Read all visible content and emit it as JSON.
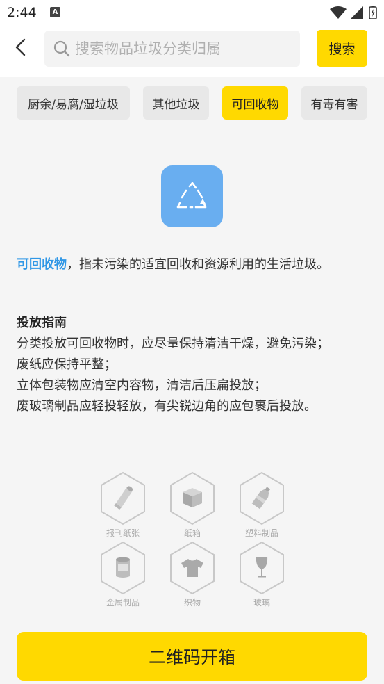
{
  "status_bar": {
    "time": "2:44",
    "notification_badge": "A",
    "icons": [
      "wifi-icon",
      "signal-icon",
      "battery-charging-icon"
    ]
  },
  "header": {
    "back_icon": "chevron-left-icon",
    "search_placeholder": "搜索物品垃圾分类归属",
    "search_value": "",
    "search_button_label": "搜索"
  },
  "tabs": [
    {
      "label": "厨余/易腐/湿垃圾",
      "active": false
    },
    {
      "label": "其他垃圾",
      "active": false
    },
    {
      "label": "可回收物",
      "active": true
    },
    {
      "label": "有毒有害",
      "active": false
    }
  ],
  "category": {
    "icon": "recycle-icon",
    "icon_color": "#69aef0",
    "name": "可回收物",
    "definition": "，指未污染的适宜回收和资源利用的生活垃圾。",
    "accent_color": "#2f97e6"
  },
  "guide": {
    "title": "投放指南",
    "lines": [
      "分类投放可回收物时，应尽量保持清洁干燥，避免污染；",
      "废纸应保持平整；",
      "立体包装物应清空内容物，清洁后压扁投放；",
      "废玻璃制品应轻投轻放，有尖锐边角的应包裹后投放。"
    ]
  },
  "examples": [
    {
      "label": "报刊纸张",
      "icon": "newspaper-roll-icon"
    },
    {
      "label": "纸箱",
      "icon": "cardboard-box-icon"
    },
    {
      "label": "塑料制品",
      "icon": "plastic-bottle-icon"
    },
    {
      "label": "金属制品",
      "icon": "metal-can-icon"
    },
    {
      "label": "织物",
      "icon": "tshirt-icon"
    },
    {
      "label": "玻璃",
      "icon": "wine-glass-icon"
    }
  ],
  "qr_button_label": "二维码开箱",
  "colors": {
    "accent_yellow": "#ffd900",
    "tab_inactive": "#e8e8e8",
    "background": "#f5f5f5"
  }
}
